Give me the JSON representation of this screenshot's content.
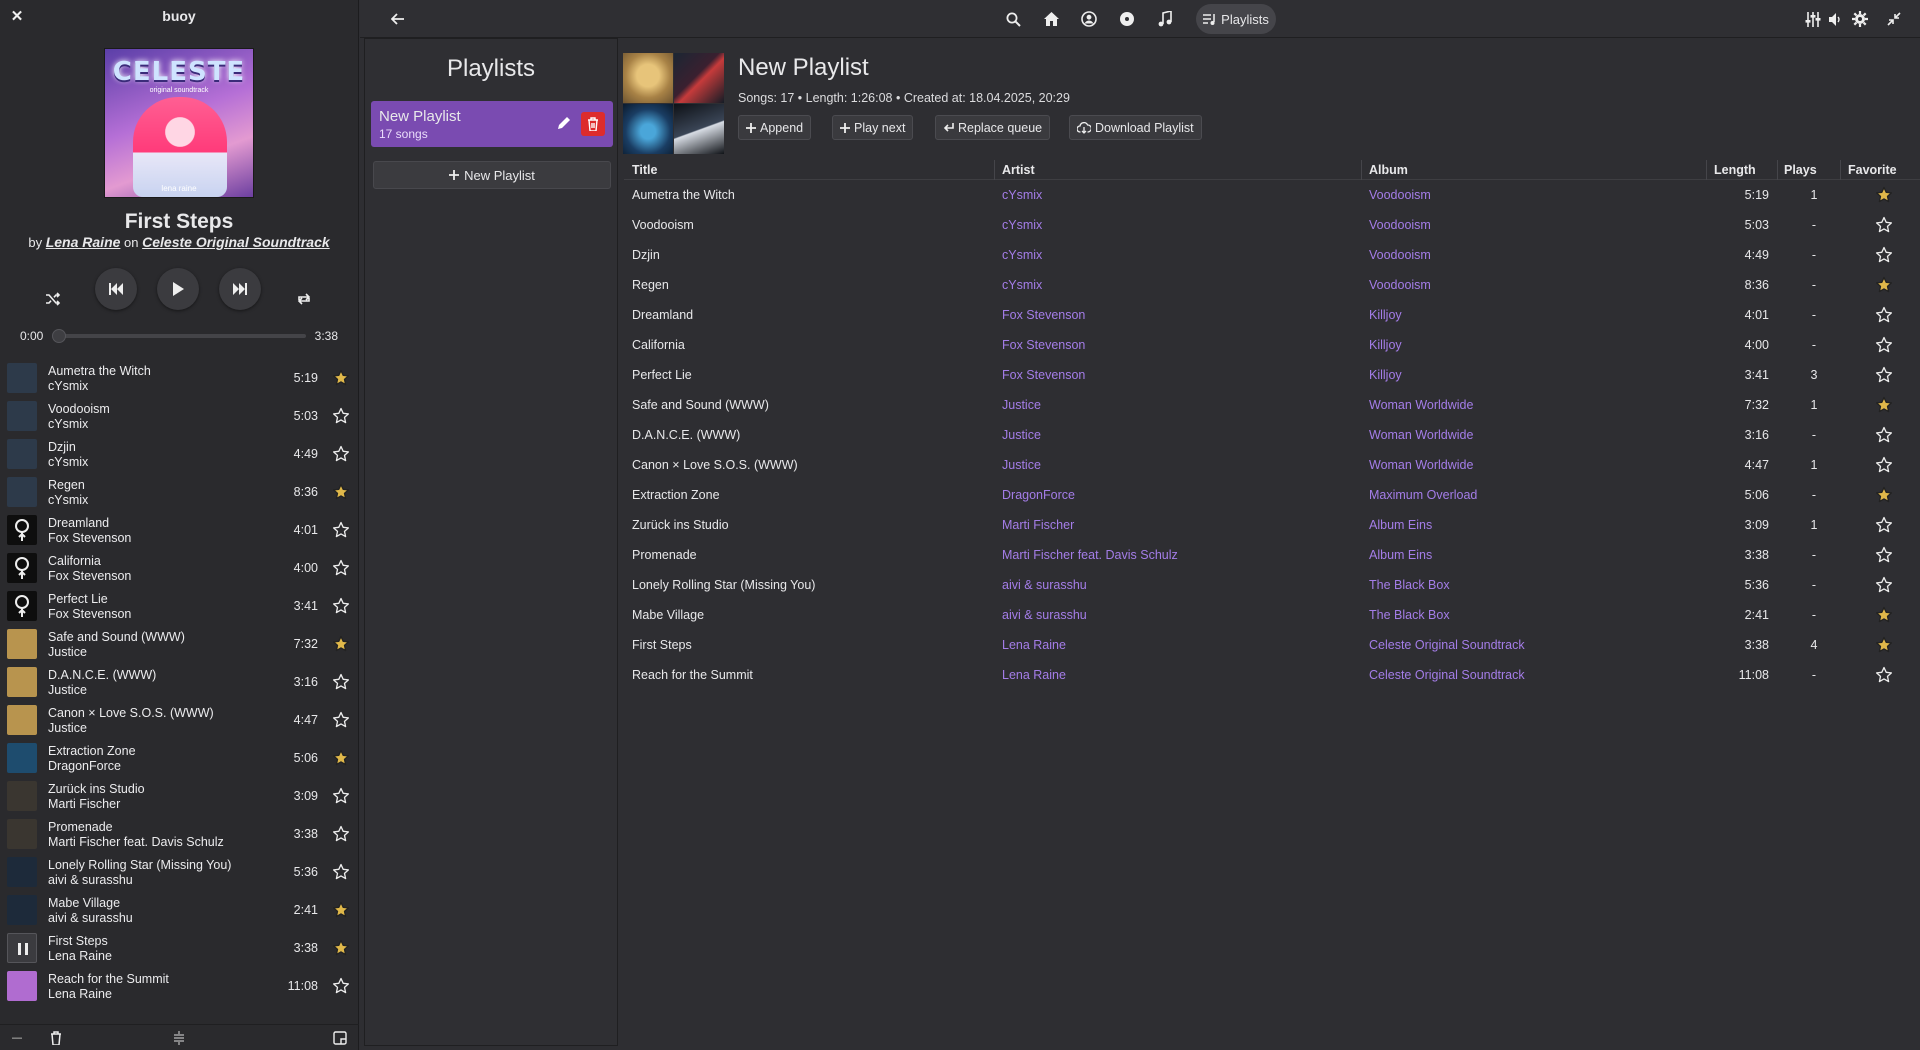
{
  "app": {
    "title": "buoy"
  },
  "now_playing": {
    "title": "First Steps",
    "by_word": "by",
    "artist": "Lena Raine",
    "on_word": "on",
    "album": "Celeste Original Soundtrack",
    "cover_title": "CELESTE",
    "cover_subtitle": "original soundtrack",
    "cover_signature": "lena raine",
    "time_current": "0:00",
    "time_total": "3:38",
    "progress_fraction": 0.0
  },
  "queue": [
    {
      "title": "Aumetra the Witch",
      "artist": "cYsmix",
      "length": "5:19",
      "favorite": true,
      "thumb": "voodooism"
    },
    {
      "title": "Voodooism",
      "artist": "cYsmix",
      "length": "5:03",
      "favorite": false,
      "thumb": "voodooism"
    },
    {
      "title": "Dzjin",
      "artist": "cYsmix",
      "length": "4:49",
      "favorite": false,
      "thumb": "voodooism"
    },
    {
      "title": "Regen",
      "artist": "cYsmix",
      "length": "8:36",
      "favorite": true,
      "thumb": "voodooism"
    },
    {
      "title": "Dreamland",
      "artist": "Fox Stevenson",
      "length": "4:01",
      "favorite": false,
      "thumb": "killjoy"
    },
    {
      "title": "California",
      "artist": "Fox Stevenson",
      "length": "4:00",
      "favorite": false,
      "thumb": "killjoy"
    },
    {
      "title": "Perfect Lie",
      "artist": "Fox Stevenson",
      "length": "3:41",
      "favorite": false,
      "thumb": "killjoy"
    },
    {
      "title": "Safe and Sound (WWW)",
      "artist": "Justice",
      "length": "7:32",
      "favorite": true,
      "thumb": "woman"
    },
    {
      "title": "D.A.N.C.E. (WWW)",
      "artist": "Justice",
      "length": "3:16",
      "favorite": false,
      "thumb": "woman"
    },
    {
      "title": "Canon × Love S.O.S. (WWW)",
      "artist": "Justice",
      "length": "4:47",
      "favorite": false,
      "thumb": "woman"
    },
    {
      "title": "Extraction Zone",
      "artist": "DragonForce",
      "length": "5:06",
      "favorite": true,
      "thumb": "overload"
    },
    {
      "title": "Zurück ins Studio",
      "artist": "Marti Fischer",
      "length": "3:09",
      "favorite": false,
      "thumb": "eins"
    },
    {
      "title": "Promenade",
      "artist": "Marti Fischer feat. Davis Schulz",
      "length": "3:38",
      "favorite": false,
      "thumb": "eins"
    },
    {
      "title": "Lonely Rolling Star (Missing You)",
      "artist": "aivi & surasshu",
      "length": "5:36",
      "favorite": false,
      "thumb": "blackbox"
    },
    {
      "title": "Mabe Village",
      "artist": "aivi & surasshu",
      "length": "2:41",
      "favorite": true,
      "thumb": "blackbox"
    },
    {
      "title": "First Steps",
      "artist": "Lena Raine",
      "length": "3:38",
      "favorite": true,
      "thumb": "playing"
    },
    {
      "title": "Reach for the Summit",
      "artist": "Lena Raine",
      "length": "11:08",
      "favorite": false,
      "thumb": "celeste"
    }
  ],
  "header": {
    "tabs": [
      {
        "name": "search-icon"
      },
      {
        "name": "home-icon"
      },
      {
        "name": "user-icon"
      },
      {
        "name": "disc-icon"
      },
      {
        "name": "music-note-icon"
      }
    ],
    "active_tab_label": "Playlists"
  },
  "playlists_panel": {
    "heading": "Playlists",
    "items": [
      {
        "name": "New Playlist",
        "count": "17 songs"
      }
    ],
    "new_button": "New Playlist"
  },
  "playlist": {
    "title": "New Playlist",
    "meta": "Songs: 17 • Length: 1:26:08 • Created at: 18.04.2025, 20:29",
    "buttons": {
      "append": "Append",
      "play_next": "Play next",
      "replace_queue": "Replace queue",
      "download": "Download Playlist"
    },
    "columns": [
      "Title",
      "Artist",
      "Album",
      "Length",
      "Plays",
      "Favorite"
    ],
    "rows": [
      {
        "title": "Aumetra the Witch",
        "artist": "cYsmix",
        "album": "Voodooism",
        "length": "5:19",
        "plays": "1",
        "favorite": true
      },
      {
        "title": "Voodooism",
        "artist": "cYsmix",
        "album": "Voodooism",
        "length": "5:03",
        "plays": "-",
        "favorite": false
      },
      {
        "title": "Dzjin",
        "artist": "cYsmix",
        "album": "Voodooism",
        "length": "4:49",
        "plays": "-",
        "favorite": false
      },
      {
        "title": "Regen",
        "artist": "cYsmix",
        "album": "Voodooism",
        "length": "8:36",
        "plays": "-",
        "favorite": true
      },
      {
        "title": "Dreamland",
        "artist": "Fox Stevenson",
        "album": "Killjoy",
        "length": "4:01",
        "plays": "-",
        "favorite": false
      },
      {
        "title": "California",
        "artist": "Fox Stevenson",
        "album": "Killjoy",
        "length": "4:00",
        "plays": "-",
        "favorite": false
      },
      {
        "title": "Perfect Lie",
        "artist": "Fox Stevenson",
        "album": "Killjoy",
        "length": "3:41",
        "plays": "3",
        "favorite": false
      },
      {
        "title": "Safe and Sound (WWW)",
        "artist": "Justice",
        "album": "Woman Worldwide",
        "length": "7:32",
        "plays": "1",
        "favorite": true
      },
      {
        "title": "D.A.N.C.E. (WWW)",
        "artist": "Justice",
        "album": "Woman Worldwide",
        "length": "3:16",
        "plays": "-",
        "favorite": false
      },
      {
        "title": "Canon × Love S.O.S. (WWW)",
        "artist": "Justice",
        "album": "Woman Worldwide",
        "length": "4:47",
        "plays": "1",
        "favorite": false
      },
      {
        "title": "Extraction Zone",
        "artist": "DragonForce",
        "album": "Maximum Overload",
        "length": "5:06",
        "plays": "-",
        "favorite": true
      },
      {
        "title": "Zurück ins Studio",
        "artist": "Marti Fischer",
        "album": "Album Eins",
        "length": "3:09",
        "plays": "1",
        "favorite": false
      },
      {
        "title": "Promenade",
        "artist": "Marti Fischer feat. Davis Schulz",
        "album": "Album Eins",
        "length": "3:38",
        "plays": "-",
        "favorite": false
      },
      {
        "title": "Lonely Rolling Star (Missing You)",
        "artist": "aivi & surasshu",
        "album": "The Black Box",
        "length": "5:36",
        "plays": "-",
        "favorite": false
      },
      {
        "title": "Mabe Village",
        "artist": "aivi & surasshu",
        "album": "The Black Box",
        "length": "2:41",
        "plays": "-",
        "favorite": true
      },
      {
        "title": "First Steps",
        "artist": "Lena Raine",
        "album": "Celeste Original Soundtrack",
        "length": "3:38",
        "plays": "4",
        "favorite": true
      },
      {
        "title": "Reach for the Summit",
        "artist": "Lena Raine",
        "album": "Celeste Original Soundtrack",
        "length": "11:08",
        "plays": "-",
        "favorite": false
      }
    ]
  },
  "colors": {
    "accent": "#7a4bb1",
    "link": "#a47de8",
    "favorite": "#e0b84a",
    "danger": "#dd2c2c",
    "thumbs": {
      "voodooism": "#2d3a4a",
      "killjoy": "#0e0e0e",
      "woman": "#b8944e",
      "overload": "#1e4c6e",
      "eins": "#3a3630",
      "blackbox": "#1d2a3a",
      "playing": "#3b3b3f",
      "celeste": "#b06cd0"
    }
  }
}
